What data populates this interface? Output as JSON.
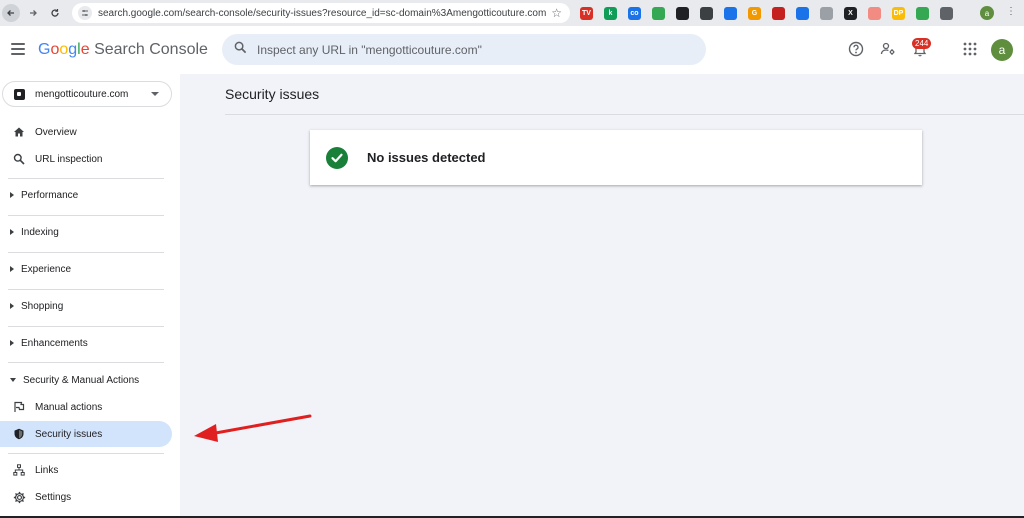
{
  "browser": {
    "url": "search.google.com/search-console/security-issues?resource_id=sc-domain%3Amengotticouture.com",
    "profile_initial": "a",
    "extensions": [
      {
        "name": "tv-extension-icon",
        "color": "#d93025",
        "label": "TV"
      },
      {
        "name": "k-extension-icon",
        "color": "#0f9d58",
        "label": "k"
      },
      {
        "name": "co-extension-icon",
        "color": "#1a73e8",
        "label": "co"
      },
      {
        "name": "keyword-extension-icon",
        "color": "#34a853",
        "label": ""
      },
      {
        "name": "pie-extension-icon",
        "color": "#202124",
        "label": ""
      },
      {
        "name": "spy-extension-icon",
        "color": "#3c4043",
        "label": ""
      },
      {
        "name": "tag-extension-icon",
        "color": "#1a73e8",
        "label": ""
      },
      {
        "name": "g-extension-icon",
        "color": "#f29900",
        "label": "G"
      },
      {
        "name": "heart-extension-icon",
        "color": "#c5221f",
        "label": ""
      },
      {
        "name": "video-extension-icon",
        "color": "#1a73e8",
        "label": ""
      },
      {
        "name": "pen-extension-icon",
        "color": "#9aa0a6",
        "label": ""
      },
      {
        "name": "x-extension-icon",
        "color": "#202124",
        "label": "X"
      },
      {
        "name": "pinkg-extension-icon",
        "color": "#f28b82",
        "label": ""
      },
      {
        "name": "dp-extension-icon",
        "color": "#fbbc05",
        "label": "DP"
      },
      {
        "name": "green-extension-icon",
        "color": "#34a853",
        "label": ""
      },
      {
        "name": "puzzle-extension-icon",
        "color": "#5f6368",
        "label": ""
      }
    ]
  },
  "header": {
    "brand": {
      "g1": "G",
      "o1": "o",
      "o2": "o",
      "g2": "g",
      "l": "l",
      "e": "e",
      "product": " Search Console"
    },
    "search_placeholder": "Inspect any URL in \"mengotticouture.com\"",
    "notification_count": "244",
    "user_initial": "a"
  },
  "sidebar": {
    "property": "mengotticouture.com",
    "items": {
      "overview": "Overview",
      "url_inspection": "URL inspection",
      "performance": "Performance",
      "indexing": "Indexing",
      "experience": "Experience",
      "shopping": "Shopping",
      "enhancements": "Enhancements",
      "security_manual": "Security & Manual Actions",
      "manual_actions": "Manual actions",
      "security_issues": "Security issues",
      "links": "Links",
      "settings": "Settings"
    }
  },
  "main": {
    "title": "Security issues",
    "status": "No issues detected"
  },
  "colors": {
    "accent": "#1a73e8",
    "active_nav": "#d2e3fc",
    "success": "#188038",
    "annotation_arrow": "#e02020"
  }
}
